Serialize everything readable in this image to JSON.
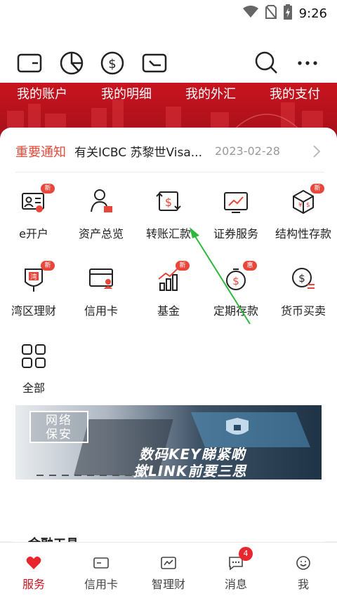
{
  "status_bar": {
    "time": "9:26",
    "icons": [
      "wifi-icon",
      "no-sim-icon",
      "battery-charging-icon"
    ]
  },
  "toolbar": {
    "left_icons": [
      "card-icon",
      "pie-chart-icon",
      "dollar-coin-icon",
      "transfer-card-icon"
    ],
    "right_icons": [
      "search-icon",
      "more-icon"
    ]
  },
  "banner_tabs": [
    "我的账户",
    "我的明细",
    "我的外汇",
    "我的支付"
  ],
  "notice": {
    "tag": "重要通知",
    "text": "有关ICBC 苏黎世Visa...",
    "date": "2023-02-28"
  },
  "services": [
    {
      "label": "e开户",
      "icon": "id-card-icon",
      "badge": "新"
    },
    {
      "label": "资产总览",
      "icon": "person-assets-icon",
      "badge": ""
    },
    {
      "label": "转账汇款",
      "icon": "transfer-icon",
      "badge": ""
    },
    {
      "label": "证券服务",
      "icon": "securities-icon",
      "badge": ""
    },
    {
      "label": "结构性存款",
      "icon": "structured-deposit-icon",
      "badge": "新"
    },
    {
      "label": "湾区理财",
      "icon": "bay-area-icon",
      "badge": "新"
    },
    {
      "label": "信用卡",
      "icon": "credit-card-icon",
      "badge": ""
    },
    {
      "label": "基金",
      "icon": "fund-chart-icon",
      "badge": "新"
    },
    {
      "label": "定期存款",
      "icon": "time-deposit-icon",
      "badge": "惠"
    },
    {
      "label": "货币买卖",
      "icon": "currency-exchange-icon",
      "badge": ""
    },
    {
      "label": "全部",
      "icon": "all-grid-icon",
      "badge": ""
    }
  ],
  "promo": {
    "badge_line1": "网络",
    "badge_line2": "保安",
    "line1": "数码KEY睇紧啲",
    "line2": "撳LINK前要三思"
  },
  "section": {
    "title": "金融工具"
  },
  "bottom_nav": [
    {
      "label": "服务",
      "icon": "heart-icon",
      "active": true
    },
    {
      "label": "信用卡",
      "icon": "card-nav-icon",
      "active": false
    },
    {
      "label": "智理财",
      "icon": "wealth-chart-icon",
      "active": false
    },
    {
      "label": "消息",
      "icon": "message-icon",
      "active": false,
      "badge": "4"
    },
    {
      "label": "我",
      "icon": "smile-icon",
      "active": false
    }
  ],
  "colors": {
    "brand_red": "#c8141f",
    "badge_red": "#e8463a",
    "notice_red": "#e84a3a",
    "arrow_green": "#2db83d"
  }
}
